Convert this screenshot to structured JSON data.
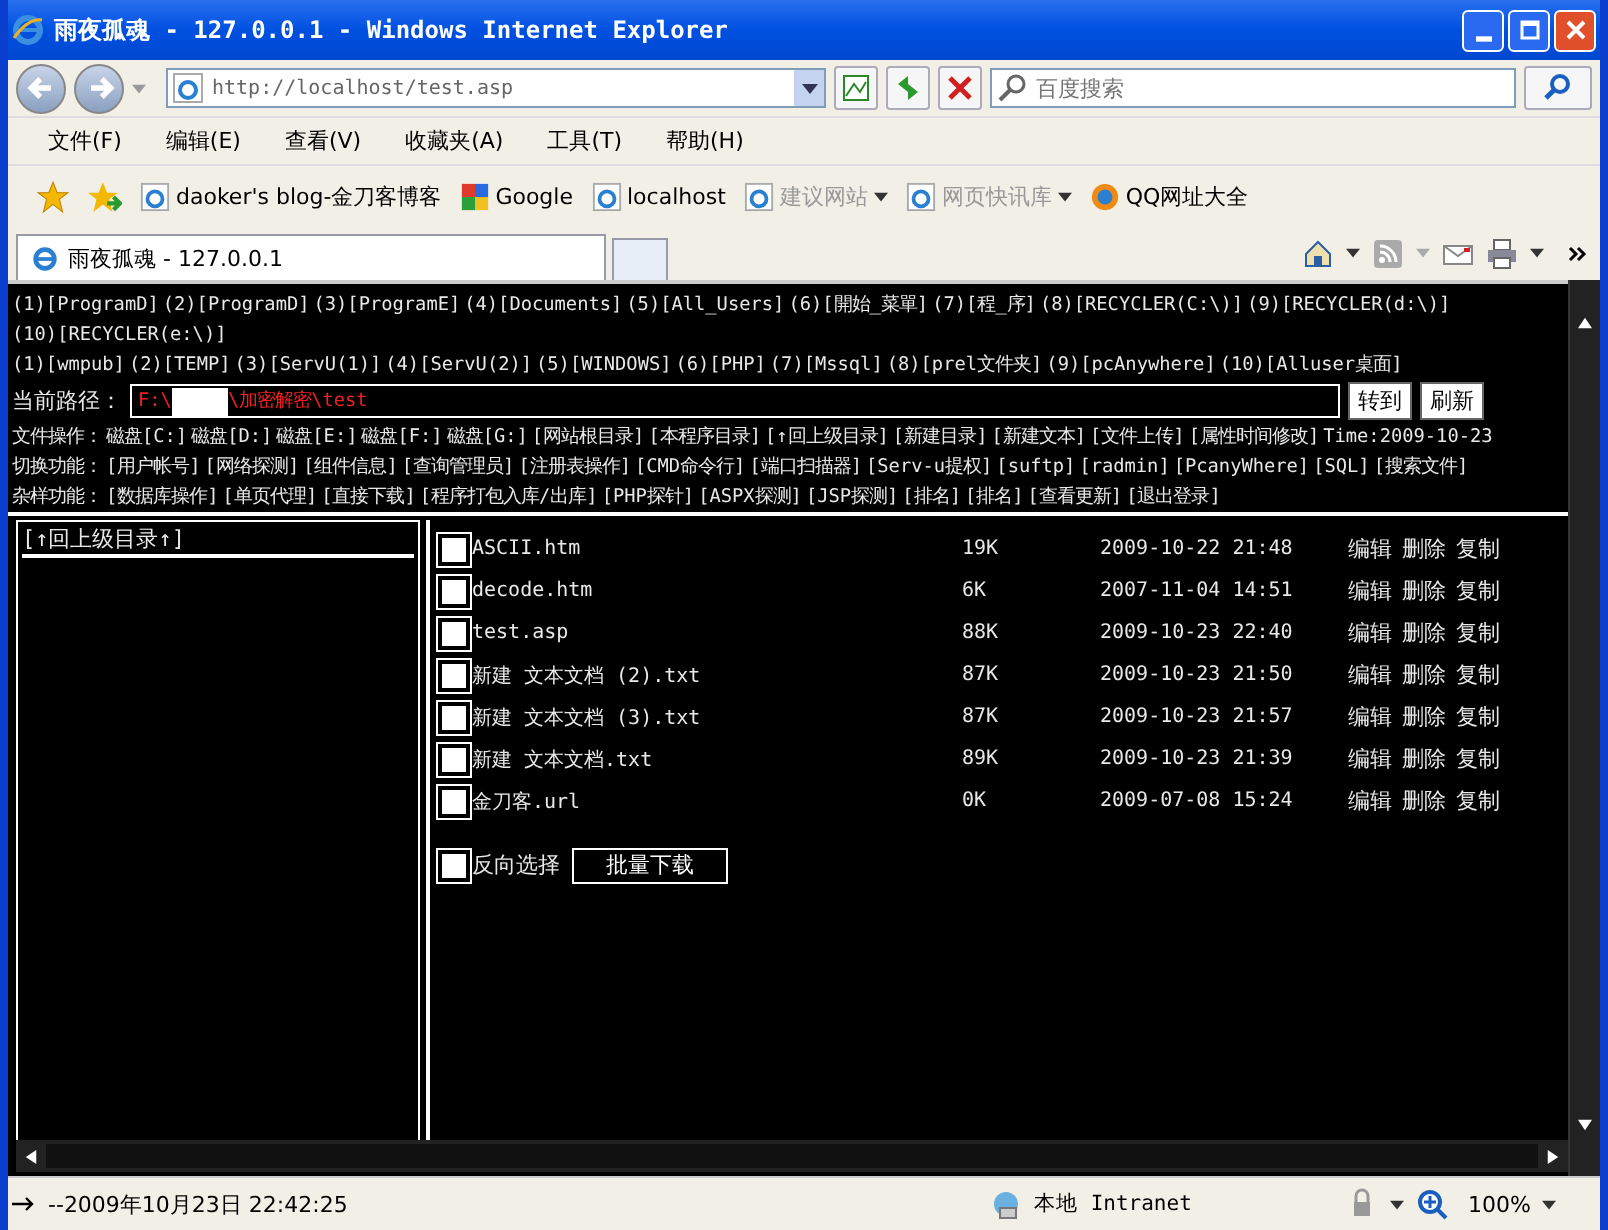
{
  "window": {
    "title": "雨夜孤魂 - 127.0.0.1 - Windows Internet Explorer"
  },
  "address": {
    "value": "http://localhost/test.asp"
  },
  "search": {
    "placeholder": "百度搜索"
  },
  "menu": [
    "文件(F)",
    "编辑(E)",
    "查看(V)",
    "收藏夹(A)",
    "工具(T)",
    "帮助(H)"
  ],
  "favorites": [
    {
      "label": "daoker's blog-金刀客博客",
      "kind": "ie",
      "dropdown": false,
      "disabled": false
    },
    {
      "label": "Google",
      "kind": "google",
      "dropdown": false,
      "disabled": false
    },
    {
      "label": "localhost",
      "kind": "ie",
      "dropdown": false,
      "disabled": false
    },
    {
      "label": "建议网站",
      "kind": "ie",
      "dropdown": true,
      "disabled": true
    },
    {
      "label": "网页快讯库",
      "kind": "ie",
      "dropdown": true,
      "disabled": true
    },
    {
      "label": "QQ网址大全",
      "kind": "qq",
      "dropdown": false,
      "disabled": false
    }
  ],
  "tabs": [
    {
      "label": "雨夜孤魂 - 127.0.0.1",
      "selected": true
    }
  ],
  "page": {
    "drive_lines": [
      [
        "(1)[ProgramD]",
        "(2)[ProgramD]",
        "(3)[ProgramE]",
        "(4)[Documents]",
        "(5)[All_Users]",
        "(6)[開始_菜單]",
        "(7)[程_序]",
        "(8)[RECYCLER(C:\\)]",
        "(9)[RECYCLER(d:\\)]",
        "(10)[RECYCLER(e:\\)]"
      ],
      [
        "(1)[wmpub]",
        "(2)[TEMP]",
        "(3)[ServU(1)]",
        "(4)[ServU(2)]",
        "(5)[WINDOWS]",
        "(6)[PHP]",
        "(7)[Mssql]",
        "(8)[prel文件夹]",
        "(9)[pcAnywhere]",
        "(10)[Alluser桌面]"
      ]
    ],
    "path_label": "当前路径：",
    "path_start": "F:\\",
    "path_end": "\\加密解密\\test",
    "path_buttons": [
      "转到",
      "刷新"
    ],
    "sections": [
      {
        "label": "文件操作：",
        "links": [
          "磁盘[C:]",
          "磁盘[D:]",
          "磁盘[E:]",
          "磁盘[F:]",
          "磁盘[G:]",
          "[网站根目录]",
          "[本程序目录]",
          "[↑回上级目录]",
          "[新建目录]",
          "[新建文本]",
          "[文件上传]",
          "[属性时间修改]"
        ],
        "note": "Time:2009-10-23"
      },
      {
        "label": "切换功能：",
        "links": [
          "[用户帐号]",
          "[网络探测]",
          "[组件信息]",
          "[查询管理员]",
          "[注册表操作]",
          "[CMD命令行]",
          "[端口扫描器]",
          "[Serv-u提权]",
          "[suftp]",
          "[radmin]",
          "[PcanyWhere]",
          "[SQL]",
          "[搜索文件]"
        ]
      },
      {
        "label": "杂样功能：",
        "links": [
          "[数据库操作]",
          "[单页代理]",
          "[直接下载]",
          "[程序打包入库/出库]",
          "[PHP探针]",
          "[ASPX探测]",
          "[JSP探测]",
          "[排名]",
          "[排名]",
          "[查看更新]",
          "[退出登录]"
        ]
      }
    ],
    "up_link": "[↑回上级目录↑]",
    "files": [
      {
        "name": "ASCII.htm",
        "size": "19K",
        "date": "2009-10-22 21:48",
        "selected": false,
        "actions": [
          "编辑",
          "删除",
          "复制"
        ]
      },
      {
        "name": "decode.htm",
        "size": "6K",
        "date": "2007-11-04 14:51",
        "selected": false,
        "actions": [
          "编辑",
          "删除",
          "复制"
        ]
      },
      {
        "name": "test.asp",
        "size": "88K",
        "date": "2009-10-23 22:40",
        "selected": false,
        "actions": [
          "编辑",
          "删除",
          "复制"
        ]
      },
      {
        "name": "新建 文本文档 (2).txt",
        "size": "87K",
        "date": "2009-10-23 21:50",
        "selected": false,
        "actions": [
          "编辑",
          "删除",
          "复制"
        ]
      },
      {
        "name": "新建 文本文档 (3).txt",
        "size": "87K",
        "date": "2009-10-23 21:57",
        "selected": false,
        "actions": [
          "编辑",
          "删除",
          "复制"
        ]
      },
      {
        "name": "新建 文本文档.txt",
        "size": "89K",
        "date": "2009-10-23 21:39",
        "selected": false,
        "actions": [
          "编辑",
          "删除",
          "复制"
        ]
      },
      {
        "name": "金刀客.url",
        "size": "0K",
        "date": "2009-07-08 15:24",
        "selected": false,
        "actions": [
          "编辑",
          "删除",
          "复制"
        ]
      }
    ],
    "invert": {
      "label": "反向选择",
      "checked": false
    },
    "batch_button": "批量下载"
  },
  "status": {
    "text": "--2009年10月23日 22:42:25",
    "zone": "本地 Intranet",
    "zoom": "100%"
  }
}
